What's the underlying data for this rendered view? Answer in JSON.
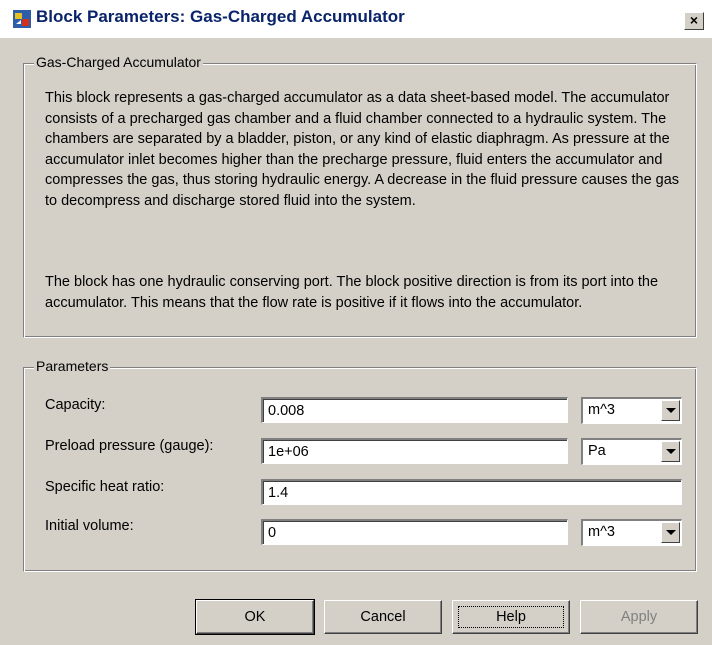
{
  "window": {
    "title": "Block Parameters: Gas-Charged Accumulator",
    "close_glyph": "×"
  },
  "description": {
    "group_title": "Gas-Charged Accumulator",
    "paragraph1": "This block represents a gas-charged accumulator as a data sheet-based model. The accumulator consists of a precharged gas chamber and a fluid chamber connected to a hydraulic system. The chambers are separated by a bladder, piston, or any kind of elastic diaphragm. As pressure at the accumulator inlet becomes higher than the precharge pressure, fluid enters the accumulator and compresses the gas, thus storing hydraulic energy. A decrease in the fluid pressure causes the gas to decompress and discharge stored fluid into the system.",
    "paragraph2": "The block has one hydraulic conserving port. The block positive direction is from its port into the accumulator. This means that the flow rate is positive if it flows into the accumulator."
  },
  "parameters": {
    "group_title": "Parameters",
    "capacity": {
      "label": "Capacity:",
      "value": "0.008",
      "unit": "m^3"
    },
    "preload_pressure": {
      "label": "Preload pressure (gauge):",
      "value": "1e+06",
      "unit": "Pa"
    },
    "specific_heat_ratio": {
      "label": "Specific heat ratio:",
      "value": "1.4"
    },
    "initial_volume": {
      "label": "Initial volume:",
      "value": "0",
      "unit": "m^3"
    }
  },
  "buttons": {
    "ok": "OK",
    "cancel": "Cancel",
    "help": "Help",
    "apply": "Apply"
  },
  "icons": {
    "app": "simulink-block-icon",
    "dropdown": "chevron-down-icon"
  },
  "colors": {
    "dialog_bg": "#d4d0c8",
    "title_text": "#0a246a",
    "disabled_text": "#808080"
  }
}
